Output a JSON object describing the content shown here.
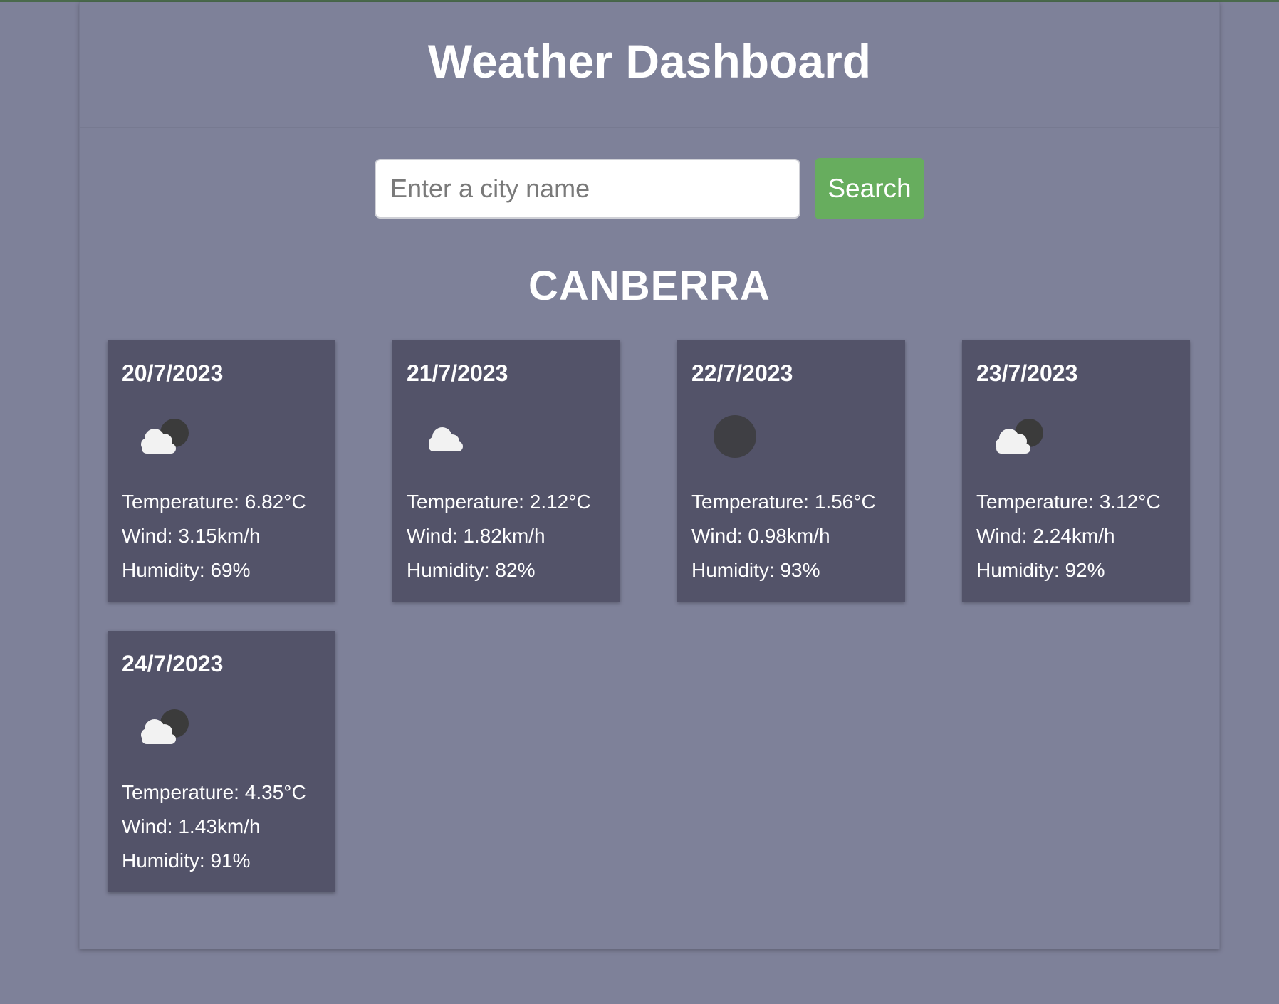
{
  "header": {
    "title": "Weather Dashboard"
  },
  "search": {
    "placeholder": "Enter a city name",
    "value": "",
    "button_label": "Search"
  },
  "city": "CANBERRA",
  "colors": {
    "accent_button": "#67ad5e",
    "card_bg": "#535369",
    "page_bg": "#7e8199"
  },
  "forecast": [
    {
      "date": "20/7/2023",
      "icon": "cloud-with-moon-icon",
      "temperature": "Temperature: 6.82°C",
      "wind": "Wind: 3.15km/h",
      "humidity": "Humidity: 69%"
    },
    {
      "date": "21/7/2023",
      "icon": "cloud-icon",
      "temperature": "Temperature: 2.12°C",
      "wind": "Wind: 1.82km/h",
      "humidity": "Humidity: 82%"
    },
    {
      "date": "22/7/2023",
      "icon": "moon-icon",
      "temperature": "Temperature: 1.56°C",
      "wind": "Wind: 0.98km/h",
      "humidity": "Humidity: 93%"
    },
    {
      "date": "23/7/2023",
      "icon": "cloud-with-moon-icon",
      "temperature": "Temperature: 3.12°C",
      "wind": "Wind: 2.24km/h",
      "humidity": "Humidity: 92%"
    },
    {
      "date": "24/7/2023",
      "icon": "cloud-with-moon-icon",
      "temperature": "Temperature: 4.35°C",
      "wind": "Wind: 1.43km/h",
      "humidity": "Humidity: 91%"
    }
  ]
}
